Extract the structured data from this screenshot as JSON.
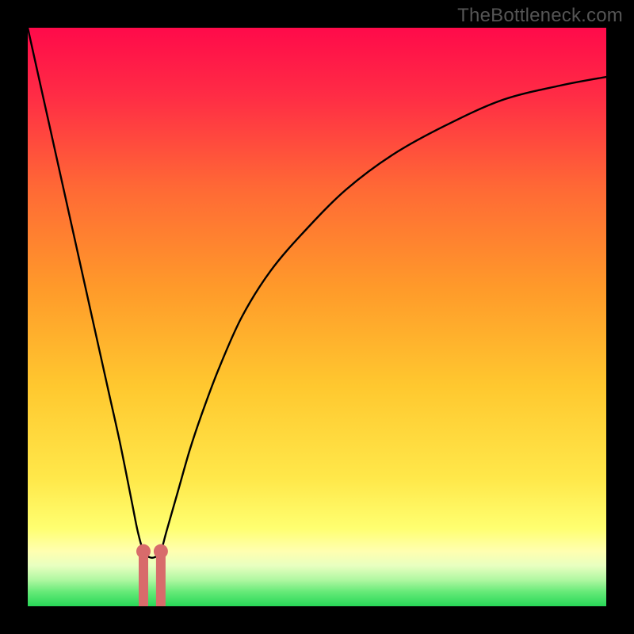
{
  "watermark": "TheBottleneck.com",
  "colors": {
    "top": "#ff0a4a",
    "orange": "#ff8a2a",
    "yellow": "#ffe84a",
    "pale_yellow": "#ffff9a",
    "pale_green": "#c8ffb0",
    "green": "#35e25d",
    "curve": "#000000",
    "marker_fill": "#d86b6b",
    "marker_stroke": "#c25555"
  },
  "chart_data": {
    "type": "line",
    "title": "",
    "xlabel": "",
    "ylabel": "",
    "ylim": [
      0,
      100
    ],
    "xlim": [
      0,
      100
    ],
    "series": [
      {
        "name": "bottleneck-curve",
        "x": [
          0,
          2,
          4,
          6,
          8,
          10,
          12,
          14,
          16,
          18,
          19,
          20,
          21,
          22,
          23,
          24,
          26,
          28,
          30,
          33,
          37,
          42,
          48,
          55,
          63,
          72,
          82,
          92,
          100
        ],
        "y": [
          100,
          91,
          82,
          73,
          64,
          55,
          46,
          37,
          28,
          18,
          13,
          9.5,
          8.5,
          8.5,
          9.5,
          13,
          20,
          27,
          33,
          41,
          50,
          58,
          65,
          72,
          78,
          83,
          87.5,
          90,
          91.5
        ]
      }
    ],
    "markers": [
      {
        "name": "optimal-left",
        "x": 20.0,
        "y": 9.5
      },
      {
        "name": "optimal-right",
        "x": 23.0,
        "y": 9.5
      }
    ],
    "legend": []
  }
}
